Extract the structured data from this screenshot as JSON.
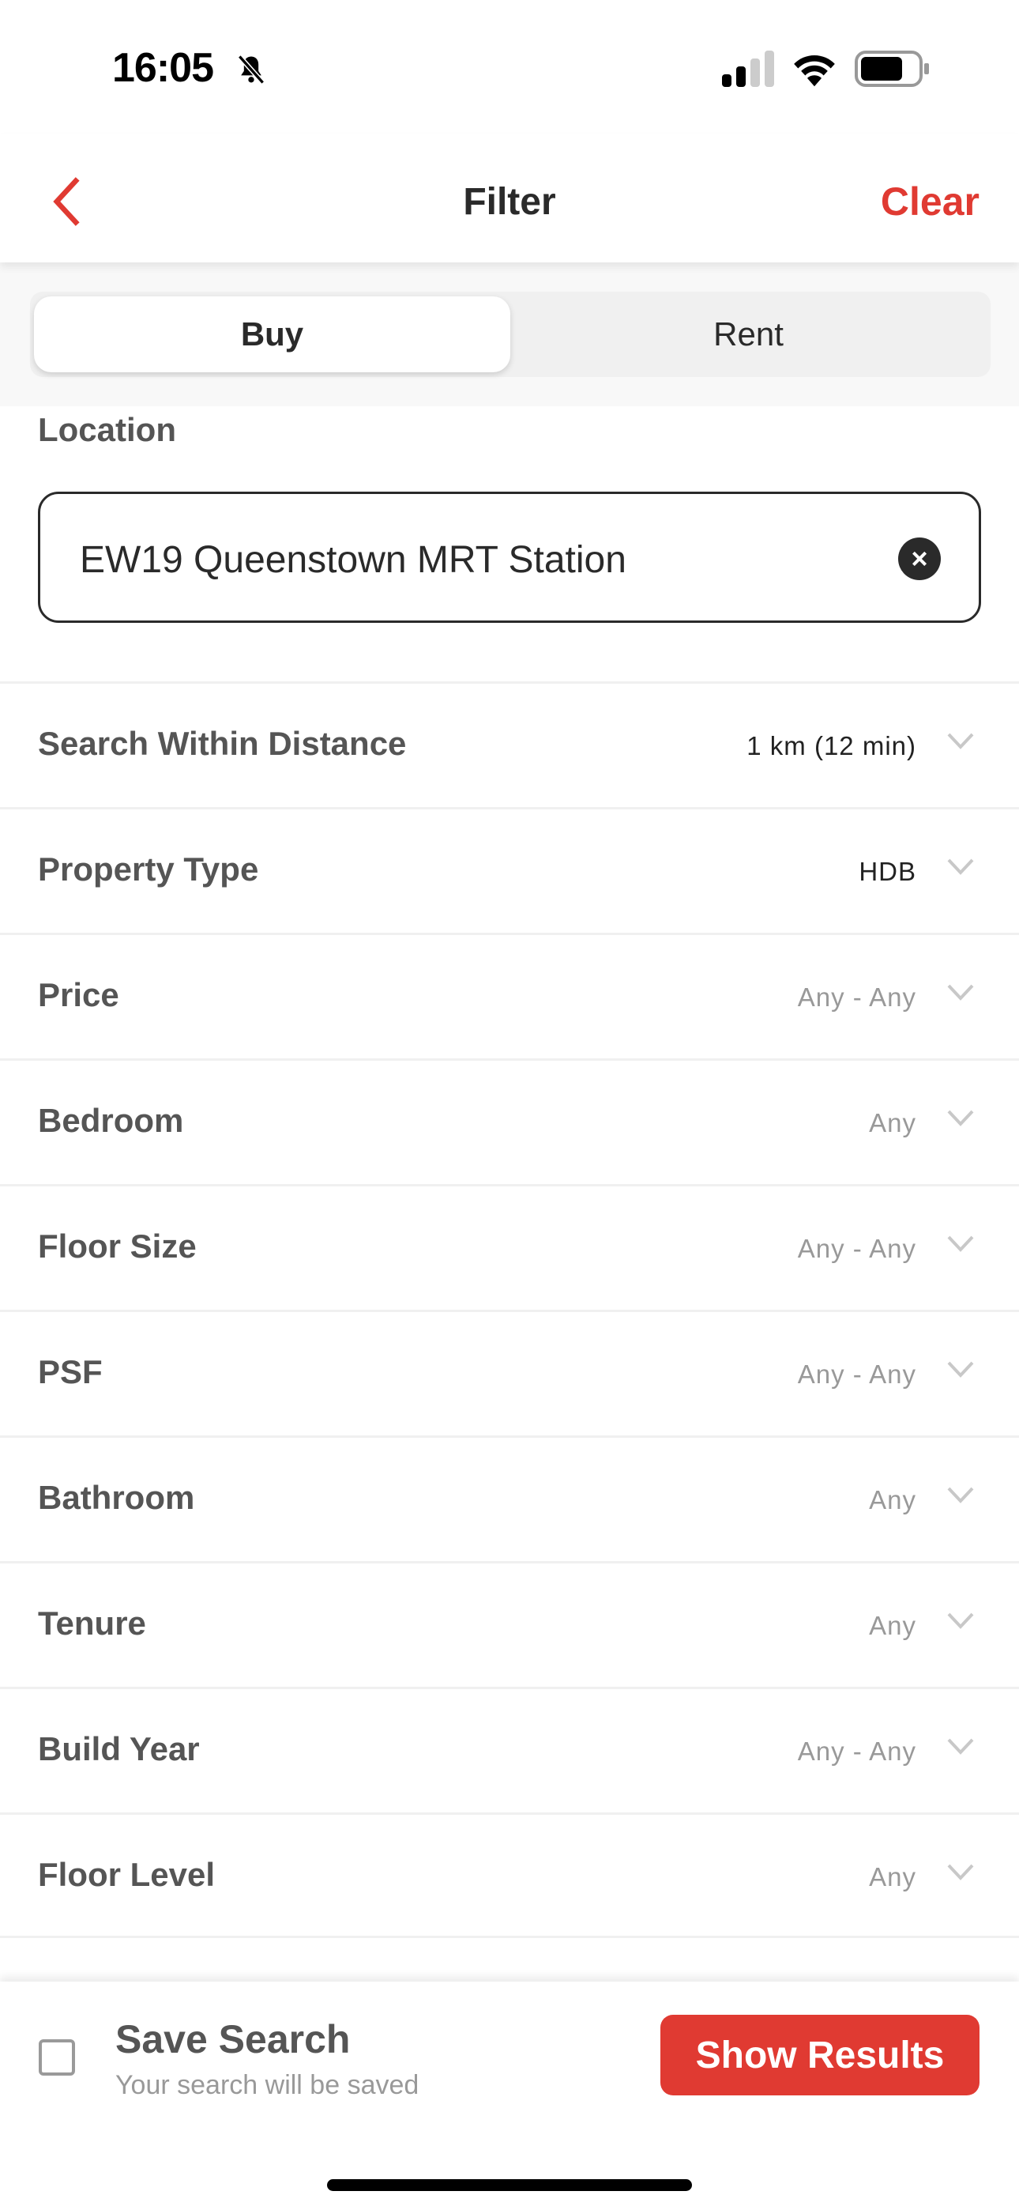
{
  "status_bar": {
    "time": "16:05",
    "icons": [
      "bell-slash-icon",
      "signal-icon",
      "wifi-icon",
      "battery-icon"
    ]
  },
  "header": {
    "title": "Filter",
    "clear_label": "Clear",
    "back_icon": "chevron-left-icon"
  },
  "tabs": [
    {
      "label": "Buy",
      "selected": true
    },
    {
      "label": "Rent",
      "selected": false
    }
  ],
  "location": {
    "label": "Location",
    "value": "EW19 Queenstown MRT Station",
    "clear_icon": "clear-circle-icon"
  },
  "filters": [
    {
      "label": "Search Within Distance",
      "value": "1 km (12 min)",
      "set": true
    },
    {
      "label": "Property Type",
      "value": "HDB",
      "set": true
    },
    {
      "label": "Price",
      "value": "Any - Any",
      "set": false
    },
    {
      "label": "Bedroom",
      "value": "Any",
      "set": false
    },
    {
      "label": "Floor Size",
      "value": "Any - Any",
      "set": false
    },
    {
      "label": "PSF",
      "value": "Any - Any",
      "set": false
    },
    {
      "label": "Bathroom",
      "value": "Any",
      "set": false
    },
    {
      "label": "Tenure",
      "value": "Any",
      "set": false
    },
    {
      "label": "Build Year",
      "value": "Any - Any",
      "set": false
    },
    {
      "label": "Floor Level",
      "value": "Any",
      "set": false
    }
  ],
  "footer": {
    "save_label": "Save Search",
    "save_sub": "Your search will be saved",
    "save_checked": false,
    "show_results_label": "Show Results"
  },
  "colors": {
    "accent": "#e03a32",
    "label": "#555555",
    "muted": "#999999"
  }
}
